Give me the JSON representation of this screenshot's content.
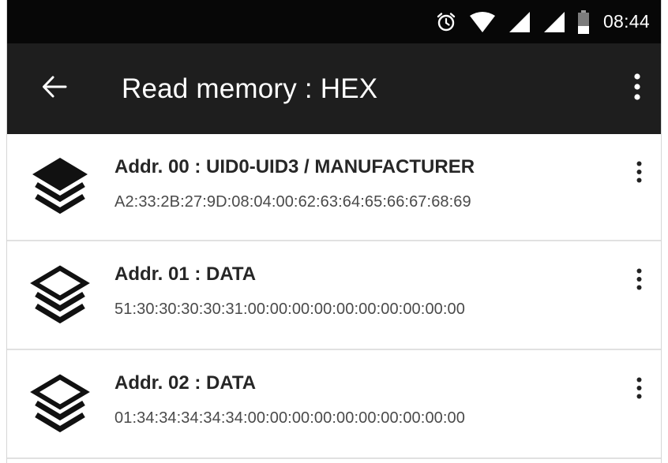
{
  "status_bar": {
    "icons": [
      "alarm-icon",
      "wifi-icon",
      "signal-icon",
      "signal-icon",
      "battery-icon"
    ],
    "time": "08:44"
  },
  "toolbar": {
    "back_icon": "arrow-back-icon",
    "title": "Read memory : HEX",
    "menu_icon": "more-vert-icon"
  },
  "memory_blocks": [
    {
      "title": "Addr. 00 : UID0-UID3 / MANUFACTURER",
      "value": "A2:33:2B:27:9D:08:04:00:62:63:64:65:66:67:68:69",
      "icon": "layers-filled-icon"
    },
    {
      "title": "Addr. 01 : DATA",
      "value": "51:30:30:30:30:31:00:00:00:00:00:00:00:00:00:00",
      "icon": "layers-outline-icon"
    },
    {
      "title": "Addr. 02 : DATA",
      "value": "01:34:34:34:34:34:00:00:00:00:00:00:00:00:00:00",
      "icon": "layers-outline-icon"
    }
  ],
  "colors": {
    "status_bar": "#070707",
    "toolbar": "#1e1e1e",
    "title_text": "#262626",
    "value_text": "#4a4a4a",
    "divider": "#e1e1e1"
  }
}
